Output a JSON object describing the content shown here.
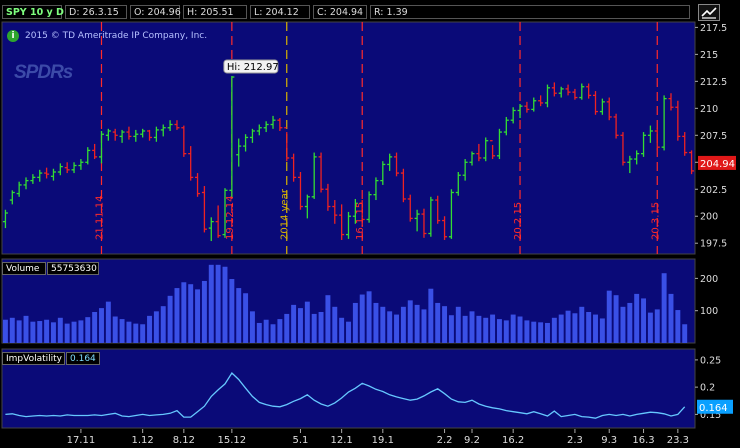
{
  "header": {
    "symbol": "SPY 10 y D",
    "date": "D: 26.3.15",
    "open": "O: 204.96",
    "high": "H: 205.51",
    "low": "L: 204.12",
    "close": "C: 204.94",
    "range": "R: 1.39"
  },
  "copyright": "2015 © TD Ameritrade IP Company, Inc.",
  "logo_text": "SPDRs",
  "hi_label": "Hi: 212.97",
  "last_price": "204.94",
  "volume_label": "Volume",
  "volume_value": "55753630",
  "iv_label": "ImpVolatility",
  "iv_value": "0.164",
  "iv_last": "0.164",
  "price_ticks": [
    "217.5",
    "215",
    "212.5",
    "210",
    "207.5",
    "205",
    "202.5",
    "200",
    "197.5"
  ],
  "volume_ticks": [
    "200",
    "100"
  ],
  "iv_ticks": [
    "0.25",
    "0.2",
    "0.15"
  ],
  "x_ticks": [
    "17.11",
    "1.12",
    "8.12",
    "15.12",
    "5.1",
    "12.1",
    "19.1",
    "2.2",
    "9.2",
    "16.2",
    "2.3",
    "9.3",
    "16.3",
    "23.3"
  ],
  "event_labels": [
    "21.11.14",
    "19.12.14",
    "2014 year",
    "16.1.15",
    "20.2.15",
    "20.3.15"
  ],
  "colors": {
    "panel_bg": "#0a0a78",
    "up_bar": "#33dd33",
    "down_bar": "#ee2222",
    "volume_bar": "#3a50e6",
    "iv_line": "#66c8ff",
    "event_line": "#ff2a2a",
    "year_line": "#d8b400",
    "last_price_bg": "#e01818"
  },
  "chart_data": {
    "type": "ohlc",
    "price_ylim": [
      196.5,
      218
    ],
    "volume_ylim": [
      0,
      260
    ],
    "iv_ylim": [
      0.125,
      0.27
    ],
    "events": [
      {
        "label": "21.11.14",
        "index": 14,
        "kind": "expiration"
      },
      {
        "label": "19.12.14",
        "index": 33,
        "kind": "expiration"
      },
      {
        "label": "2014 year",
        "index": 41,
        "kind": "year"
      },
      {
        "label": "16.1.15",
        "index": 52,
        "kind": "expiration"
      },
      {
        "label": "20.2.15",
        "index": 75,
        "kind": "expiration"
      },
      {
        "label": "20.3.15",
        "index": 95,
        "kind": "expiration"
      }
    ],
    "x_tick_index": [
      11,
      20,
      26,
      33,
      43,
      49,
      55,
      64,
      68,
      74,
      83,
      88,
      93,
      98
    ],
    "ohlc": [
      [
        199.5,
        200.6,
        198.9,
        200.3
      ],
      [
        201.5,
        202.4,
        201.1,
        202.2
      ],
      [
        202.1,
        203.2,
        201.8,
        202.9
      ],
      [
        202.9,
        203.6,
        202.5,
        203.3
      ],
      [
        203.3,
        203.9,
        203.0,
        203.6
      ],
      [
        203.6,
        204.3,
        203.2,
        204.0
      ],
      [
        204.0,
        204.5,
        203.5,
        203.9
      ],
      [
        203.7,
        204.4,
        203.3,
        204.1
      ],
      [
        204.1,
        204.9,
        203.8,
        204.6
      ],
      [
        204.5,
        205.0,
        204.0,
        204.3
      ],
      [
        204.3,
        205.0,
        204.0,
        204.7
      ],
      [
        204.7,
        205.3,
        204.3,
        205.0
      ],
      [
        205.0,
        206.4,
        204.8,
        206.1
      ],
      [
        206.1,
        206.7,
        205.3,
        205.5
      ],
      [
        205.5,
        207.9,
        204.9,
        207.6
      ],
      [
        207.5,
        208.1,
        207.0,
        207.9
      ],
      [
        207.8,
        208.1,
        207.0,
        207.5
      ],
      [
        207.4,
        208.0,
        206.8,
        207.8
      ],
      [
        207.8,
        208.3,
        207.1,
        207.4
      ],
      [
        207.4,
        208.0,
        206.9,
        207.6
      ],
      [
        207.6,
        208.1,
        207.3,
        207.9
      ],
      [
        207.9,
        208.0,
        207.0,
        207.3
      ],
      [
        207.3,
        208.3,
        206.9,
        208.0
      ],
      [
        208.0,
        208.5,
        207.4,
        208.2
      ],
      [
        208.2,
        208.9,
        207.9,
        208.5
      ],
      [
        208.5,
        208.9,
        208.0,
        208.2
      ],
      [
        208.2,
        208.4,
        205.5,
        205.8
      ],
      [
        205.8,
        206.5,
        203.3,
        203.6
      ],
      [
        203.6,
        204.0,
        201.8,
        202.1
      ],
      [
        202.2,
        202.8,
        198.5,
        198.8
      ],
      [
        198.9,
        199.9,
        197.7,
        199.5
      ],
      [
        199.5,
        201.0,
        198.0,
        198.2
      ],
      [
        198.3,
        202.6,
        198.0,
        202.4
      ],
      [
        202.4,
        213.0,
        201.7,
        212.9
      ],
      [
        205.7,
        207.2,
        204.6,
        206.5
      ],
      [
        206.5,
        207.6,
        206.0,
        207.3
      ],
      [
        207.3,
        208.1,
        206.8,
        207.9
      ],
      [
        207.9,
        208.5,
        207.5,
        208.2
      ],
      [
        208.2,
        208.8,
        207.8,
        208.5
      ],
      [
        208.5,
        209.3,
        208.1,
        208.9
      ],
      [
        208.9,
        209.1,
        207.9,
        208.2
      ],
      [
        208.2,
        207.8,
        205.1,
        205.4
      ],
      [
        205.4,
        205.8,
        203.2,
        203.6
      ],
      [
        203.6,
        204.1,
        200.6,
        200.9
      ],
      [
        200.9,
        202.0,
        199.8,
        201.8
      ],
      [
        201.8,
        205.9,
        201.6,
        205.5
      ],
      [
        205.5,
        205.9,
        202.2,
        202.5
      ],
      [
        202.5,
        203.0,
        200.5,
        200.9
      ],
      [
        200.9,
        201.5,
        199.3,
        200.1
      ],
      [
        200.1,
        201.1,
        197.8,
        198.3
      ],
      [
        198.3,
        200.4,
        197.9,
        200.0
      ],
      [
        200.0,
        201.6,
        199.3,
        201.2
      ],
      [
        201.2,
        201.5,
        199.4,
        199.7
      ],
      [
        199.7,
        202.3,
        199.4,
        202.0
      ],
      [
        202.0,
        203.6,
        201.5,
        203.3
      ],
      [
        203.3,
        205.1,
        202.9,
        204.8
      ],
      [
        204.8,
        205.8,
        204.2,
        205.5
      ],
      [
        205.5,
        205.9,
        203.7,
        204.0
      ],
      [
        204.0,
        204.4,
        201.3,
        201.6
      ],
      [
        201.6,
        202.0,
        199.5,
        199.8
      ],
      [
        199.8,
        200.6,
        198.6,
        200.2
      ],
      [
        200.2,
        200.7,
        198.0,
        198.4
      ],
      [
        198.4,
        201.8,
        198.1,
        201.5
      ],
      [
        201.5,
        201.9,
        199.3,
        199.6
      ],
      [
        199.6,
        200.0,
        197.8,
        198.1
      ],
      [
        198.1,
        202.5,
        197.9,
        202.2
      ],
      [
        202.2,
        204.1,
        201.9,
        203.8
      ],
      [
        203.8,
        205.3,
        203.3,
        205.0
      ],
      [
        205.0,
        206.0,
        204.7,
        205.8
      ],
      [
        205.8,
        206.7,
        205.1,
        205.4
      ],
      [
        205.4,
        207.3,
        205.1,
        207.0
      ],
      [
        207.0,
        206.6,
        205.3,
        205.6
      ],
      [
        205.6,
        208.1,
        205.3,
        207.8
      ],
      [
        207.8,
        209.2,
        207.5,
        208.9
      ],
      [
        208.9,
        210.1,
        208.6,
        209.8
      ],
      [
        209.8,
        210.4,
        209.1,
        210.2
      ],
      [
        210.2,
        210.6,
        209.6,
        209.9
      ],
      [
        209.9,
        211.0,
        209.7,
        210.7
      ],
      [
        210.7,
        211.2,
        210.2,
        210.5
      ],
      [
        210.5,
        212.2,
        210.1,
        211.9
      ],
      [
        211.9,
        212.4,
        211.1,
        211.4
      ],
      [
        211.4,
        212.0,
        211.0,
        211.8
      ],
      [
        211.8,
        212.2,
        211.2,
        211.5
      ],
      [
        211.5,
        211.8,
        210.8,
        211.0
      ],
      [
        211.0,
        212.3,
        210.8,
        212.0
      ],
      [
        212.0,
        212.3,
        210.9,
        211.2
      ],
      [
        211.2,
        211.6,
        209.4,
        209.7
      ],
      [
        209.7,
        210.9,
        209.4,
        210.6
      ],
      [
        210.6,
        211.0,
        208.9,
        209.2
      ],
      [
        209.2,
        209.5,
        207.2,
        207.5
      ],
      [
        207.5,
        207.8,
        204.7,
        205.0
      ],
      [
        205.0,
        205.6,
        204.0,
        205.3
      ],
      [
        205.3,
        206.1,
        204.8,
        205.8
      ],
      [
        205.8,
        207.8,
        205.5,
        207.5
      ],
      [
        207.5,
        208.4,
        206.8,
        207.9
      ],
      [
        207.9,
        208.2,
        206.1,
        206.4
      ],
      [
        206.4,
        211.2,
        206.1,
        210.9
      ],
      [
        210.9,
        211.4,
        209.8,
        210.1
      ],
      [
        210.1,
        210.7,
        207.0,
        207.4
      ],
      [
        207.4,
        207.8,
        205.6,
        205.9
      ],
      [
        205.9,
        206.1,
        203.9,
        204.2
      ]
    ],
    "volume": [
      72,
      78,
      70,
      84,
      66,
      68,
      72,
      64,
      78,
      60,
      66,
      70,
      80,
      96,
      108,
      128,
      82,
      74,
      66,
      60,
      58,
      84,
      98,
      114,
      146,
      170,
      188,
      182,
      166,
      192,
      242,
      242,
      236,
      198,
      170,
      154,
      98,
      62,
      72,
      58,
      74,
      90,
      118,
      108,
      128,
      90,
      96,
      148,
      112,
      78,
      66,
      124,
      150,
      160,
      124,
      112,
      98,
      88,
      112,
      132,
      118,
      104,
      168,
      124,
      114,
      86,
      112,
      84,
      98,
      84,
      78,
      88,
      74,
      70,
      88,
      82,
      70,
      66,
      64,
      62,
      78,
      88,
      100,
      92,
      112,
      96,
      88,
      76,
      162,
      148,
      112,
      124,
      152,
      138,
      94,
      104,
      216,
      152,
      102,
      58
    ],
    "iv": [
      0.15,
      0.151,
      0.148,
      0.146,
      0.147,
      0.148,
      0.147,
      0.148,
      0.147,
      0.149,
      0.148,
      0.148,
      0.148,
      0.149,
      0.148,
      0.15,
      0.152,
      0.147,
      0.146,
      0.148,
      0.15,
      0.148,
      0.149,
      0.15,
      0.152,
      0.157,
      0.145,
      0.145,
      0.155,
      0.165,
      0.183,
      0.195,
      0.206,
      0.226,
      0.214,
      0.198,
      0.183,
      0.172,
      0.168,
      0.165,
      0.164,
      0.168,
      0.174,
      0.179,
      0.186,
      0.176,
      0.169,
      0.165,
      0.171,
      0.18,
      0.191,
      0.198,
      0.207,
      0.202,
      0.196,
      0.192,
      0.186,
      0.182,
      0.179,
      0.176,
      0.178,
      0.184,
      0.191,
      0.197,
      0.188,
      0.178,
      0.173,
      0.172,
      0.176,
      0.169,
      0.165,
      0.162,
      0.16,
      0.157,
      0.155,
      0.153,
      0.151,
      0.155,
      0.151,
      0.147,
      0.156,
      0.146,
      0.148,
      0.15,
      0.146,
      0.145,
      0.143,
      0.148,
      0.15,
      0.148,
      0.15,
      0.147,
      0.15,
      0.152,
      0.154,
      0.153,
      0.151,
      0.147,
      0.15,
      0.164
    ]
  }
}
